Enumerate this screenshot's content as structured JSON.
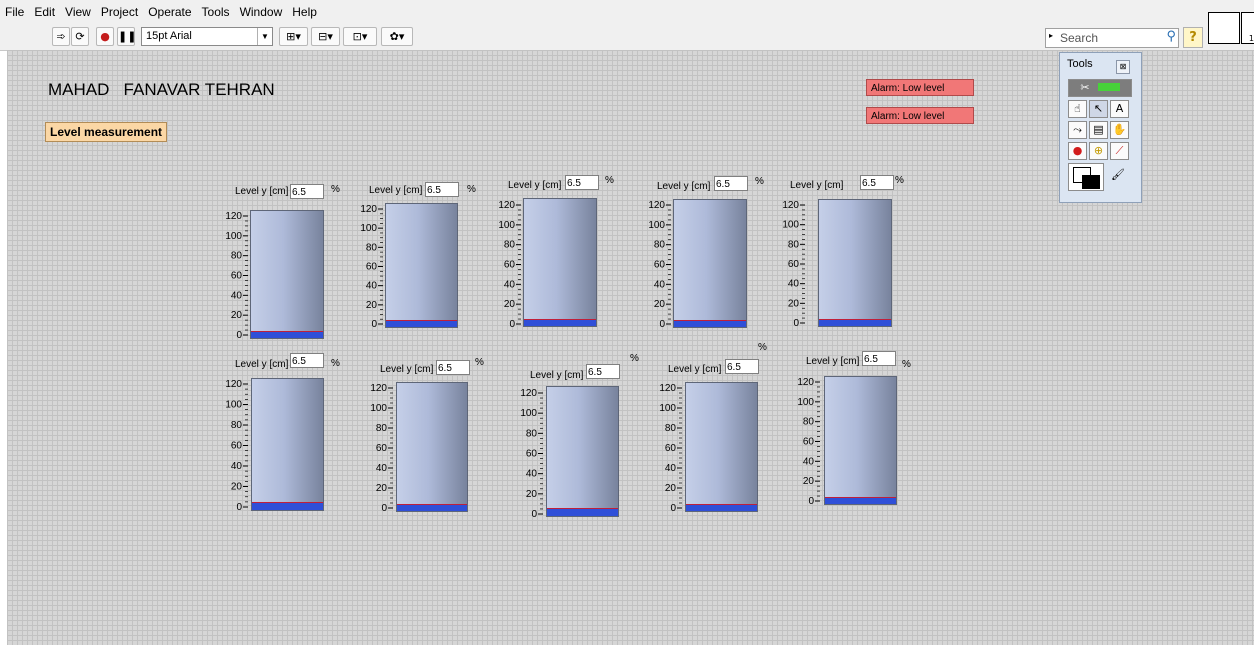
{
  "menu": [
    "File",
    "Edit",
    "View",
    "Project",
    "Operate",
    "Tools",
    "Window",
    "Help"
  ],
  "toolbar": {
    "font_select": "15pt Arial",
    "search_placeholder": "Search"
  },
  "title": "MAHAD   FANAVAR TEHRAN",
  "level_measurement_label": "Level measurement",
  "alarms": [
    "Alarm: Low level",
    "Alarm: Low level"
  ],
  "tools_palette": {
    "title": "Tools"
  },
  "tank_scale": [
    "120",
    "100",
    "80",
    "60",
    "40",
    "20",
    "0"
  ],
  "tank_scale_max": 120,
  "tanks": [
    {
      "label": "Level y [cm]",
      "value": "6.5",
      "unit": "%",
      "level": 6.5
    },
    {
      "label": "Level y [cm]",
      "value": "6.5",
      "unit": "%",
      "level": 6.5
    },
    {
      "label": "Level y [cm]",
      "value": "6.5",
      "unit": "%",
      "level": 6.5
    },
    {
      "label": "Level y [cm]",
      "value": "6.5",
      "unit": "%",
      "level": 6.5
    },
    {
      "label": "Level y [cm]",
      "value": "6.5",
      "unit": "%",
      "level": 6.5
    },
    {
      "label": "Level y [cm]",
      "value": "6.5",
      "unit": "%",
      "level": 6.5
    },
    {
      "label": "Level y [cm]",
      "value": "6.5",
      "unit": "%",
      "level": 6.5
    },
    {
      "label": "Level y [cm]",
      "value": "6.5",
      "unit": "%",
      "level": 6.5
    },
    {
      "label": "Level y [cm]",
      "value": "6.5",
      "unit": "%",
      "level": 6.5
    },
    {
      "label": "Level y [cm]",
      "value": "6.5",
      "unit": "%",
      "level": 6.5
    }
  ],
  "colors": {
    "alarm": "#f17777",
    "fill": "#2f4fd8",
    "level_label_bg": "#fbd7a5"
  }
}
